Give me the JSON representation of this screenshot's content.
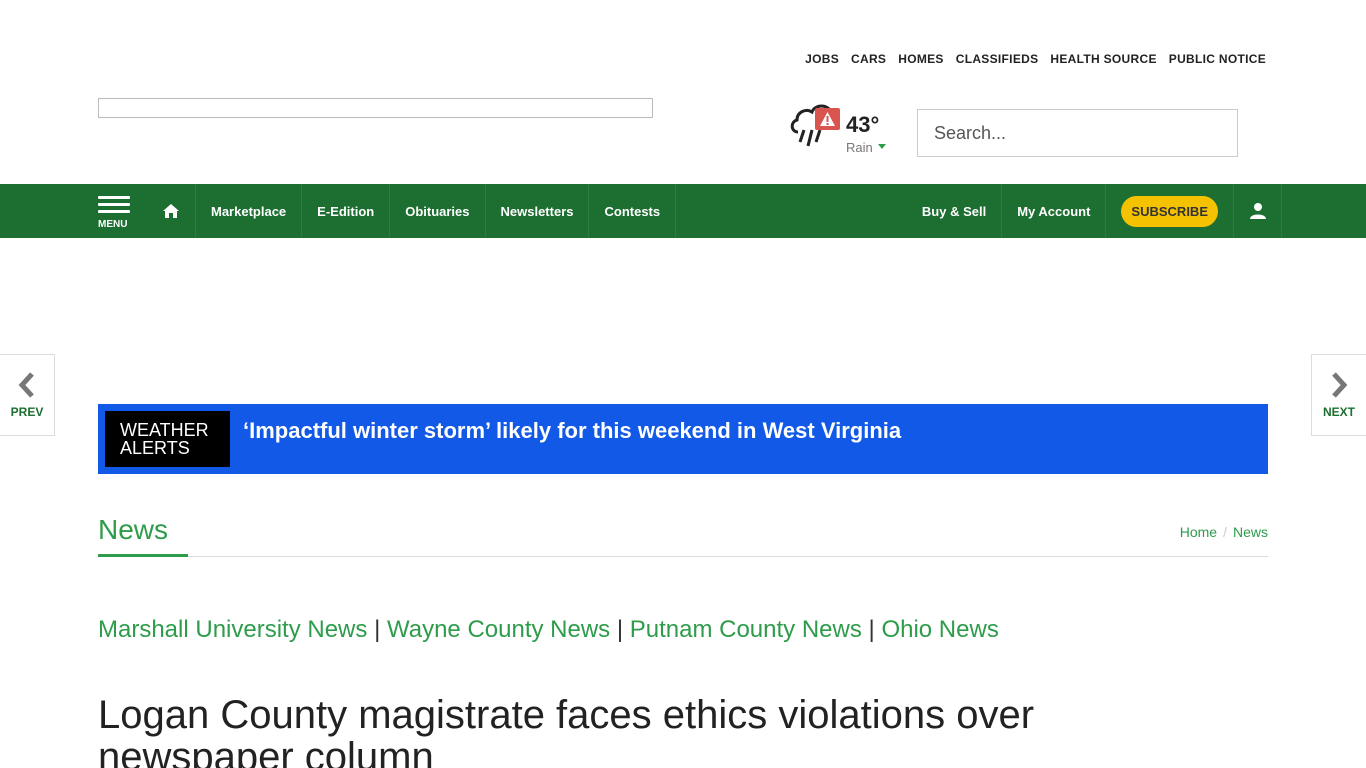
{
  "top_links": [
    "JOBS",
    "CARS",
    "HOMES",
    "CLASSIFIEDS",
    "HEALTH SOURCE",
    "PUBLIC NOTICE"
  ],
  "weather": {
    "temperature": "43°",
    "condition": "Rain"
  },
  "search": {
    "placeholder": "Search..."
  },
  "nav": {
    "menu_label": "MENU",
    "items": [
      "Marketplace",
      "E-Edition",
      "Obituaries",
      "Newsletters",
      "Contests"
    ],
    "right_items": [
      "Buy & Sell",
      "My Account"
    ],
    "subscribe_label": "SUBSCRIBE"
  },
  "pager": {
    "prev_label": "PREV",
    "next_label": "NEXT"
  },
  "alert": {
    "tag": "WEATHER ALERTS",
    "headline": "‘Impactful winter storm’ likely for this weekend in West Virginia"
  },
  "section": {
    "title": "News"
  },
  "breadcrumb": [
    "Home",
    "News"
  ],
  "subnav": {
    "links": [
      "Marshall University News",
      "Wayne County News",
      "Putnam County News",
      "Ohio News"
    ],
    "separator": "|"
  },
  "article": {
    "headline": "Logan County magistrate faces ethics violations over newspaper column"
  },
  "colors": {
    "nav_green": "#1c6e31",
    "link_green": "#2e9c4a",
    "alert_blue": "#1159e6",
    "subscribe_yellow": "#f5c200"
  }
}
